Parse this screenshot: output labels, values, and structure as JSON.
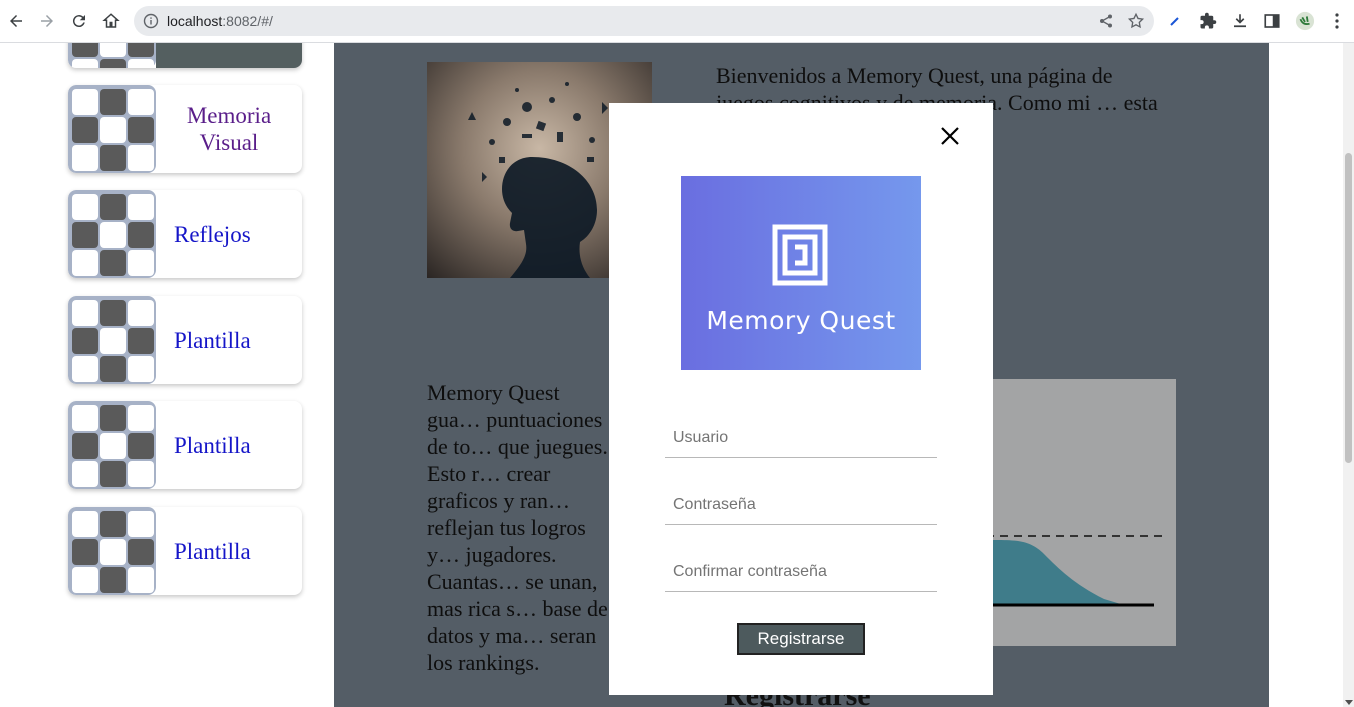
{
  "browser": {
    "url_host": "localhost",
    "url_rest": ":8082/#/"
  },
  "sidebar": {
    "items": [
      {
        "label": "Memoria Visual"
      },
      {
        "label": "Reflejos"
      },
      {
        "label": "Plantilla"
      },
      {
        "label": "Plantilla"
      },
      {
        "label": "Plantilla"
      }
    ]
  },
  "main": {
    "intro_text": "Bienvenidos a Memory Quest, una página de juegos cognitivos y de memoria. Como mi … esta plataforma … fios mentales",
    "ranking_text": "Memory Quest gua… puntuaciones de to… que juegues. Esto r… crear graficos y ran… reflejan tus logros y… jugadores. Cuantas… se unan, mas rica s… base de datos y ma… seran los rankings.",
    "bottom_heading": "Registrarse"
  },
  "modal": {
    "logo_text": "Memory Quest",
    "username_placeholder": "Usuario",
    "password_placeholder": "Contraseña",
    "confirm_placeholder": "Confirmar contraseña",
    "submit_label": "Registrarse"
  },
  "colors": {
    "overlay": "#545d66",
    "button": "#4d5a5d",
    "link": "#1515c8",
    "visited_link": "#5a1e8a",
    "logo_gradient_start": "#6a6ee0",
    "logo_gradient_end": "#7598ed"
  },
  "icons": [
    "back-icon",
    "forward-icon",
    "reload-icon",
    "home-icon",
    "info-icon",
    "share-icon",
    "star-icon",
    "pen-extension-icon",
    "puzzle-extension-icon",
    "download-icon",
    "sidepanel-icon",
    "profile-avatar",
    "kebab-menu-icon",
    "close-icon"
  ]
}
